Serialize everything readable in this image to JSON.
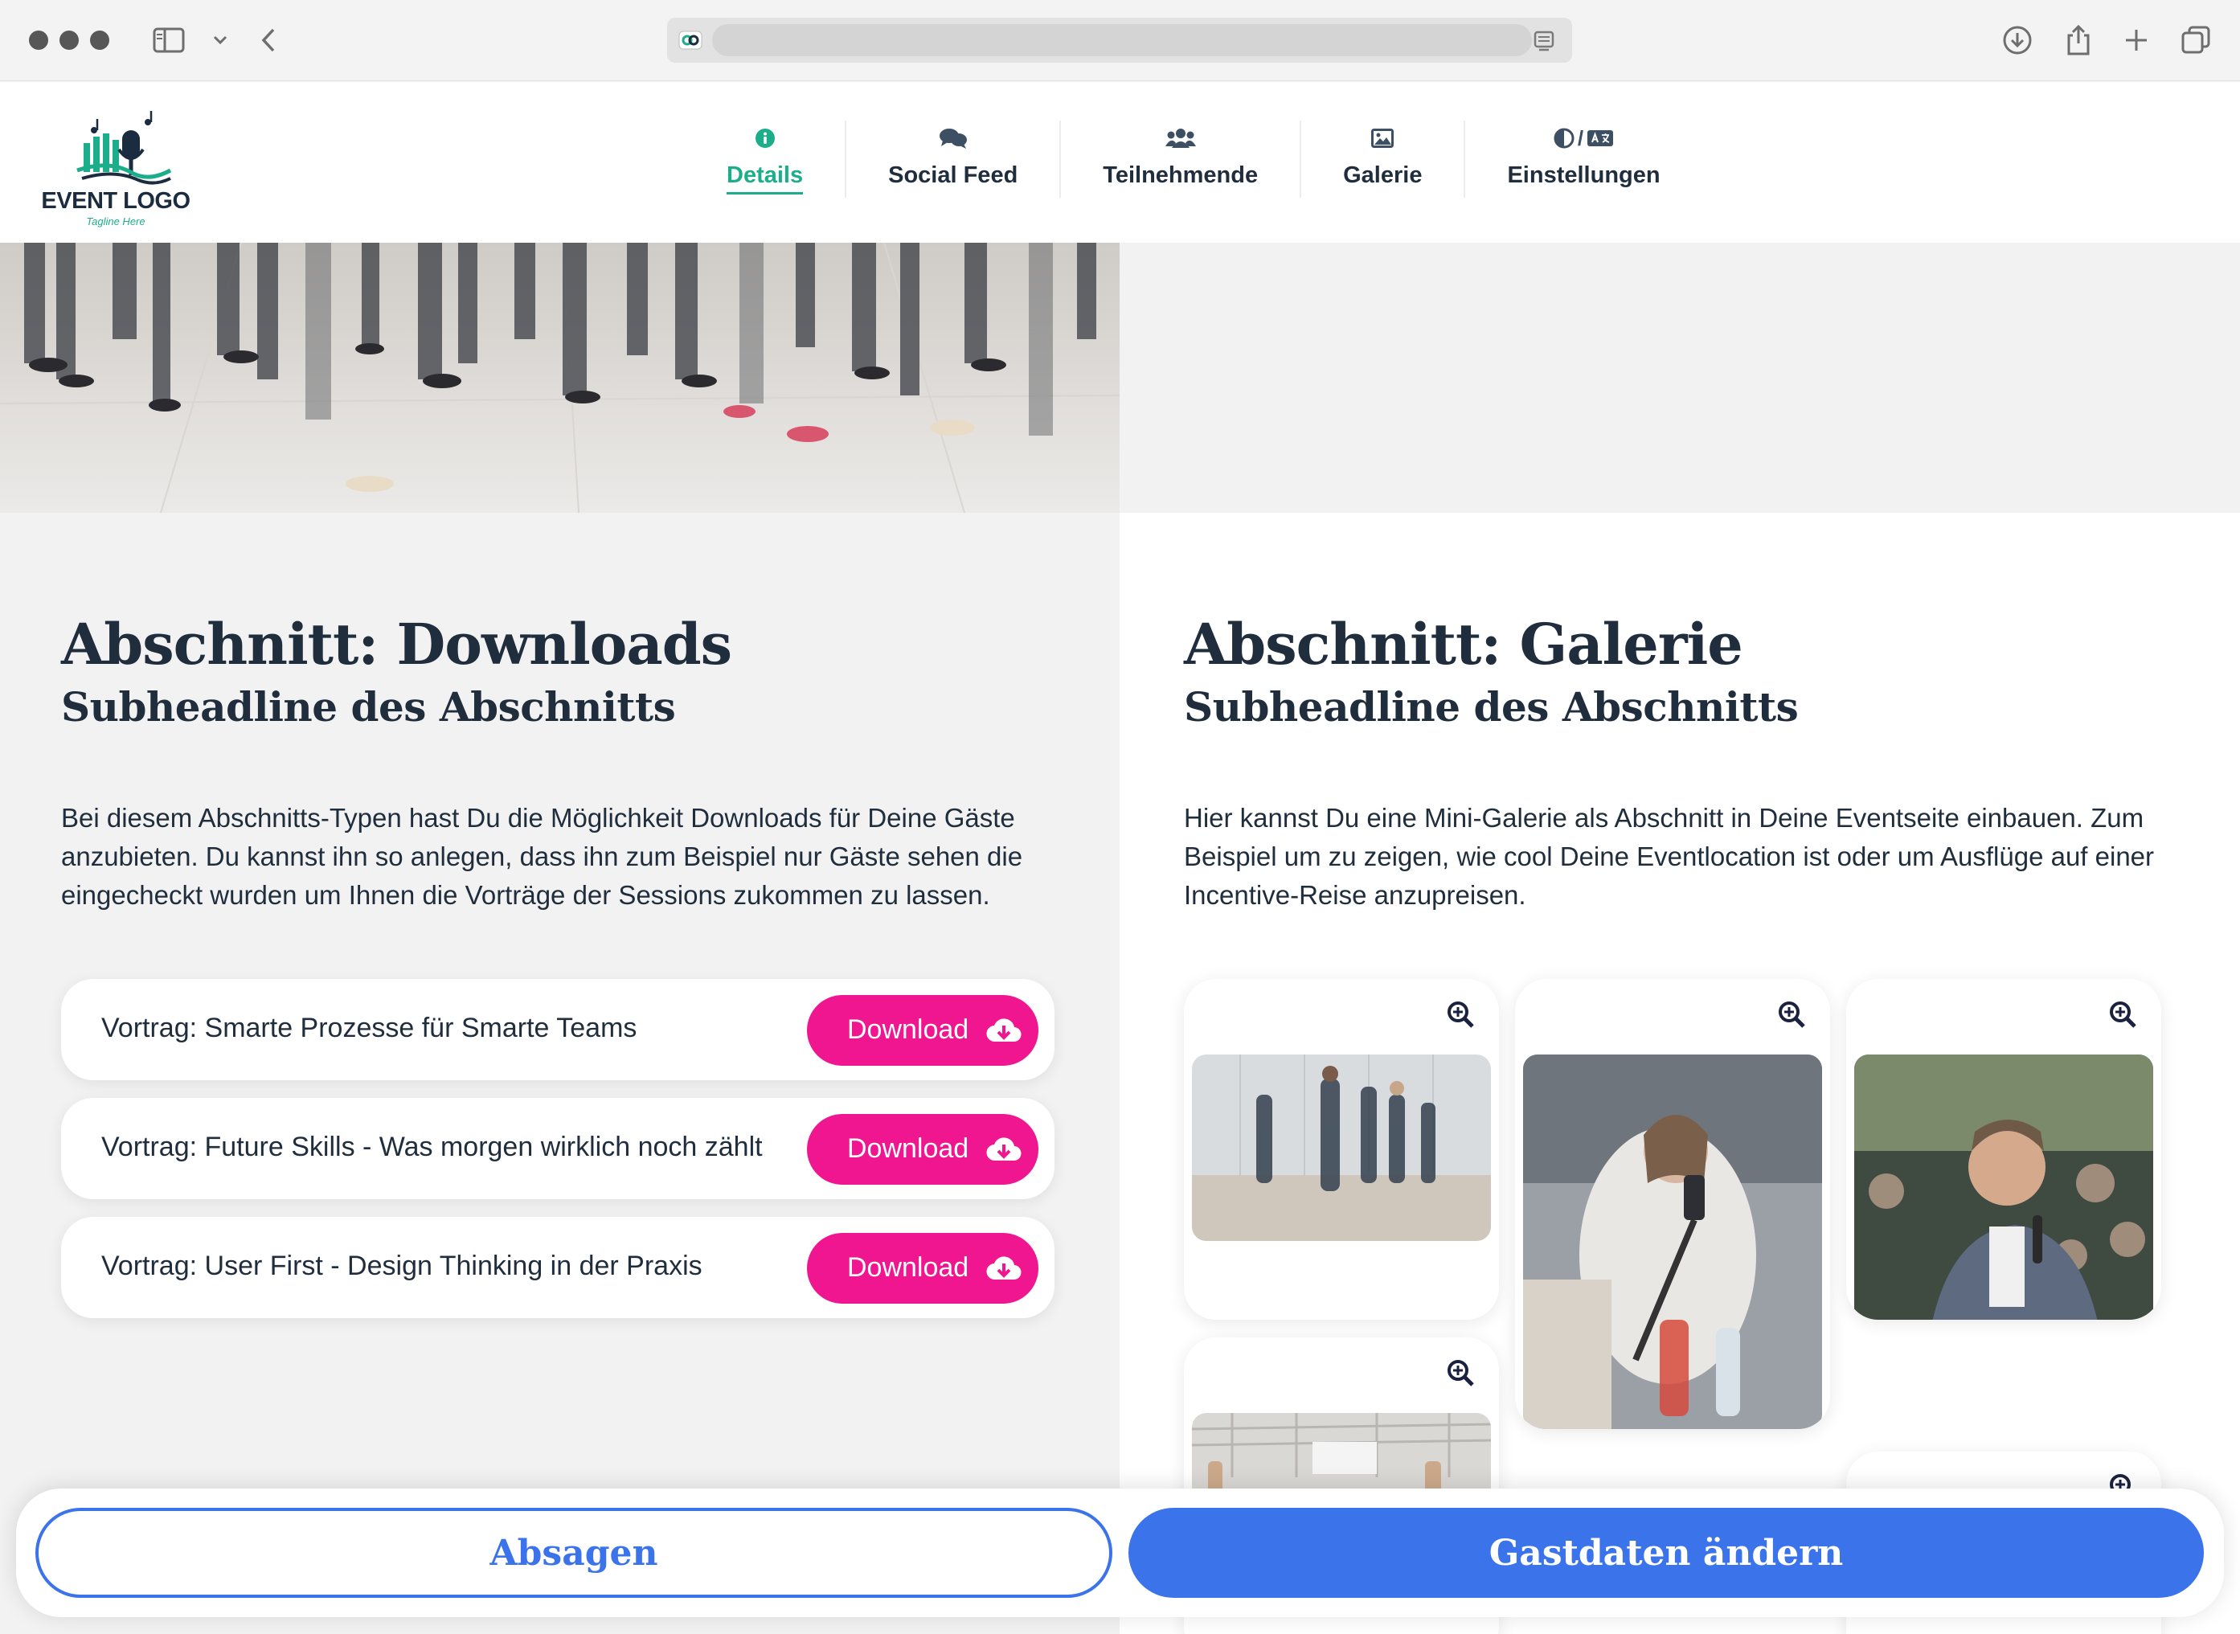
{
  "nav": {
    "items": [
      {
        "label": "Details",
        "icon": "info-circle-icon",
        "active": true
      },
      {
        "label": "Social Feed",
        "icon": "chat-bubbles-icon",
        "active": false
      },
      {
        "label": "Teilnehmende",
        "icon": "users-icon",
        "active": false
      },
      {
        "label": "Galerie",
        "icon": "image-icon",
        "active": false
      },
      {
        "label": "Einstellungen",
        "icon": "contrast-language-icon",
        "active": false
      }
    ],
    "settings_separator": "/"
  },
  "logo": {
    "text": "EVENT LOGO",
    "tagline": "Tagline Here"
  },
  "downloads": {
    "title": "Abschnitt: Downloads",
    "subtitle": "Subheadline des Abschnitts",
    "body_lines": [
      "Bei diesem Abschnitts-Typen hast Du die Möglichkeit Downloads für Deine Gäste",
      "anzubieten. Du kannst ihn so anlegen, dass ihn zum Beispiel nur Gäste sehen die",
      "eingecheckt wurden um Ihnen die Vorträge der Sessions zukommen zu lassen."
    ],
    "items": [
      {
        "label": "Vortrag: Smarte Prozesse für Smarte Teams",
        "button": "Download"
      },
      {
        "label": "Vortrag: Future Skills - Was morgen wirklich noch zählt",
        "button": "Download"
      },
      {
        "label": "Vortrag: User First - Design Thinking in der Praxis",
        "button": "Download"
      }
    ]
  },
  "gallery": {
    "title": "Abschnitt: Galerie",
    "subtitle": "Subheadline des Abschnitts",
    "body_lines": [
      "Hier kannst Du eine Mini-Galerie als Abschnitt in Deine Eventseite einbauen. Zum",
      "Beispiel um zu zeigen, wie cool Deine Eventlocation ist oder um Ausflüge auf einer",
      "Incentive-Reise anzupreisen."
    ]
  },
  "actions": {
    "cancel": "Absagen",
    "edit": "Gastdaten ändern"
  },
  "colors": {
    "accent": "#1cae8b",
    "download": "#f0168f",
    "primary": "#3b73ea",
    "text": "#1f2d3d"
  }
}
